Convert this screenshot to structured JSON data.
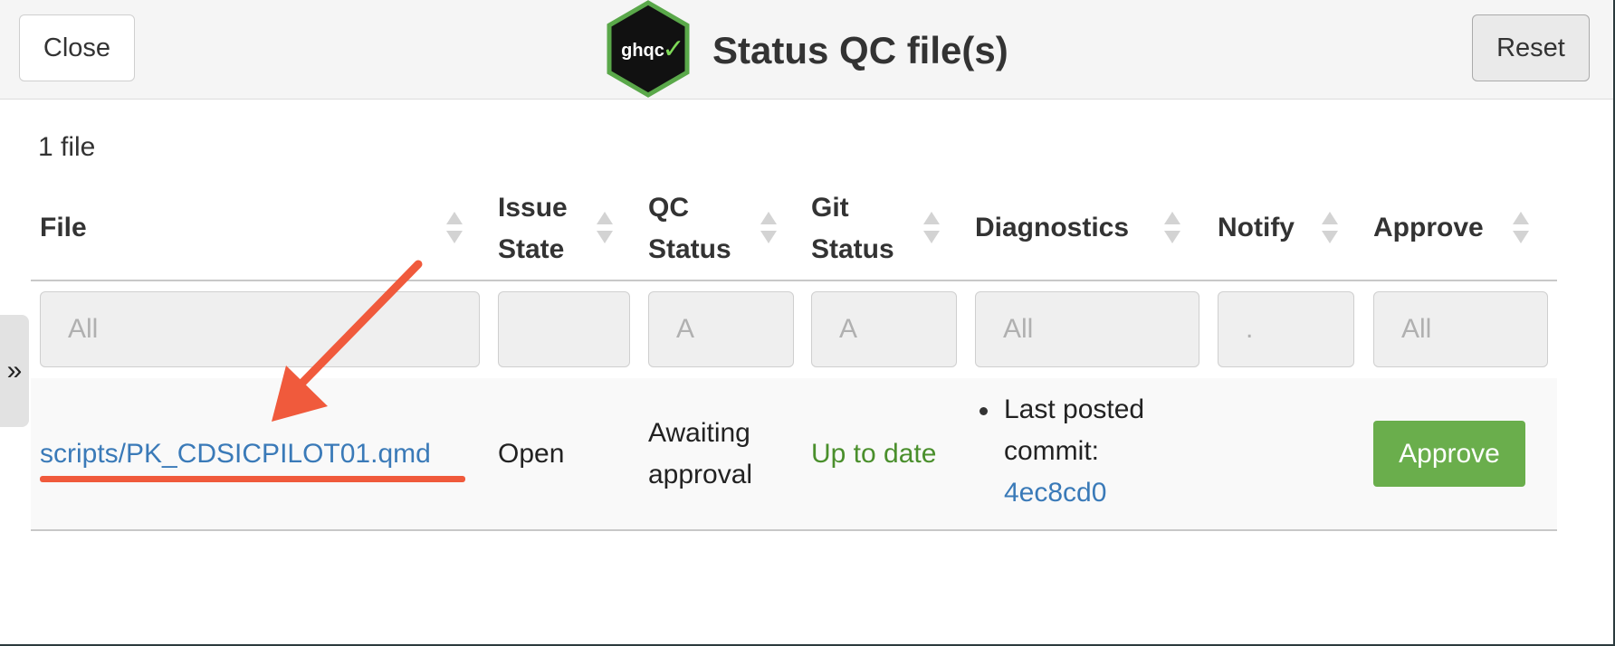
{
  "header": {
    "close_label": "Close",
    "reset_label": "Reset",
    "title": "Status QC file(s)",
    "logo_text": "ghqc✓"
  },
  "sidebar_toggle": "»",
  "file_count": "1 file",
  "table": {
    "columns": {
      "file": "File",
      "issue_state": [
        "Issue",
        "State"
      ],
      "qc_status": [
        "QC",
        "Status"
      ],
      "git_status": [
        "Git",
        "Status"
      ],
      "diagnostics": "Diagnostics",
      "notify": "Notify",
      "approve": "Approve"
    },
    "filters": {
      "file": "All",
      "issue_state": "",
      "qc_status": "A",
      "git_status": "A",
      "diagnostics": "All",
      "notify": ".",
      "approve": "All"
    },
    "rows": [
      {
        "file": "scripts/PK_CDSICPILOT01.qmd",
        "issue_state": "Open",
        "qc_status": [
          "Awaiting",
          "approval"
        ],
        "git_status": "Up to date",
        "diagnostics": {
          "line1": "Last posted",
          "line2": "commit:",
          "commit": "4ec8cd0"
        },
        "notify": "",
        "approve_label": "Approve"
      }
    ]
  },
  "colors": {
    "link": "#3a7ab8",
    "git_up_to_date": "#4a8f2c",
    "approve_button": "#6aae4c",
    "annotation": "#f05a3c",
    "logo_hex_bg": "#111111",
    "logo_hex_border": "#5aa84a"
  }
}
